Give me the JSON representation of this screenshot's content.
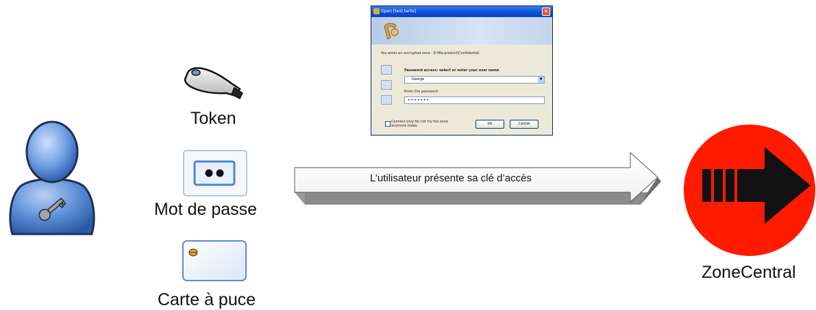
{
  "items": {
    "token_label": "Token",
    "password_label": "Mot de passe",
    "smartcard_label": "Carte à puce"
  },
  "arrow": {
    "label": "L’utilisateur présente sa clé d’accès"
  },
  "target": {
    "label": "ZoneCentral"
  },
  "dialog": {
    "title": "Open [test.tarlis]",
    "info_text": "You enter an encrypted zone : E:\\Ma product\\Confidential",
    "access_label": "Password access: select or enter your user name",
    "user_value": "George",
    "password_prompt": "Enter the password:",
    "password_value": "•••••••",
    "checkbox_label": "Connect only for not try the zone anymore today",
    "ok_label": "Ok",
    "cancel_label": "Cancel"
  },
  "icons": {
    "user": "user-with-key-icon",
    "token": "usb-token-icon",
    "password": "password-dots-icon",
    "smartcard": "smart-card-icon",
    "target": "red-circle-arrow-icon"
  },
  "colors": {
    "user_blue": "#5b8fd6",
    "target_red": "#ff1a00",
    "arrow_black": "#111111"
  }
}
